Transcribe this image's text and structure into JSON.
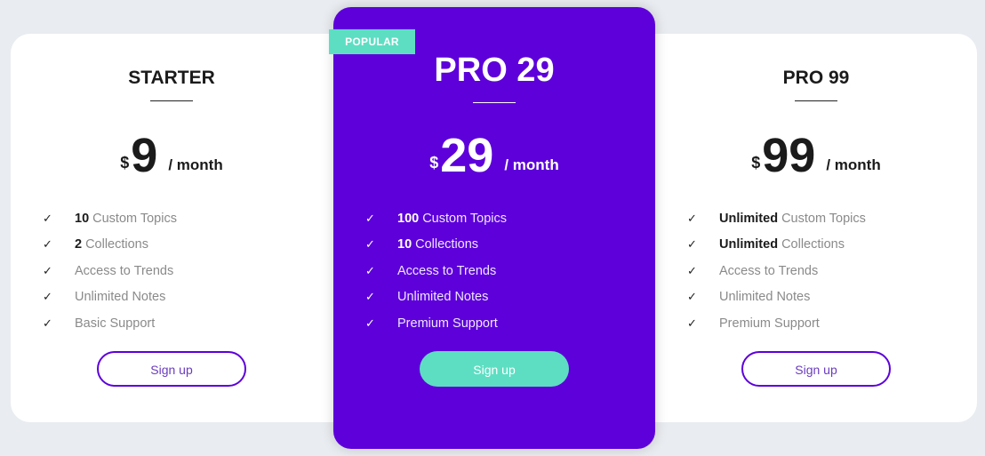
{
  "colors": {
    "background": "#e9ecf0",
    "accent_purple": "#5d00da",
    "accent_teal": "#5ddec2"
  },
  "plans": [
    {
      "name": "STARTER",
      "currency": "$",
      "amount": "9",
      "period": "/ month",
      "features": [
        {
          "icon": "check-icon",
          "bold": "10",
          "text": "Custom Topics"
        },
        {
          "icon": "check-icon",
          "bold": "2",
          "text": "Collections"
        },
        {
          "icon": "check-icon",
          "bold": "",
          "text": "Access to Trends"
        },
        {
          "icon": "check-icon",
          "bold": "",
          "text": "Unlimited Notes"
        },
        {
          "icon": "check-icon",
          "bold": "",
          "text": "Basic Support"
        }
      ],
      "button": "Sign up"
    },
    {
      "badge": "POPULAR",
      "name": "PRO 29",
      "currency": "$",
      "amount": "29",
      "period": "/ month",
      "features": [
        {
          "icon": "check-icon",
          "bold": "100",
          "text": "Custom Topics"
        },
        {
          "icon": "check-icon",
          "bold": "10",
          "text": "Collections"
        },
        {
          "icon": "check-icon",
          "bold": "",
          "text": "Access to Trends"
        },
        {
          "icon": "check-icon",
          "bold": "",
          "text": "Unlimited Notes"
        },
        {
          "icon": "check-icon",
          "bold": "",
          "text": "Premium Support"
        }
      ],
      "button": "Sign up"
    },
    {
      "name": "PRO 99",
      "currency": "$",
      "amount": "99",
      "period": "/ month",
      "features": [
        {
          "icon": "check-icon",
          "bold": "Unlimited",
          "text": "Custom Topics"
        },
        {
          "icon": "check-icon",
          "bold": "Unlimited",
          "text": "Collections"
        },
        {
          "icon": "check-icon",
          "bold": "",
          "text": "Access to Trends"
        },
        {
          "icon": "check-icon",
          "bold": "",
          "text": "Unlimited Notes"
        },
        {
          "icon": "check-icon",
          "bold": "",
          "text": "Premium Support"
        }
      ],
      "button": "Sign up"
    }
  ]
}
